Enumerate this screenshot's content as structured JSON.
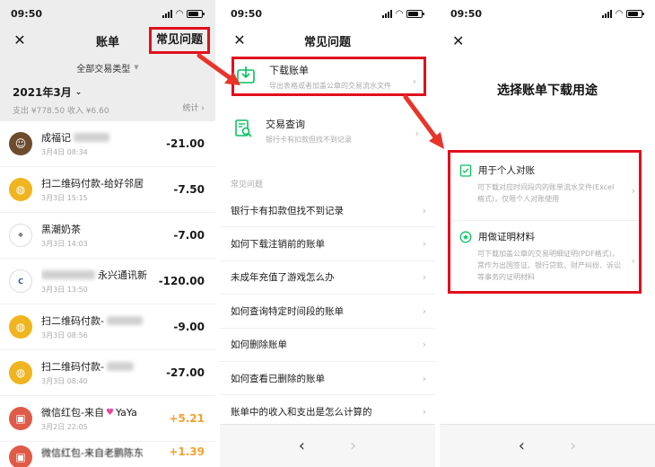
{
  "status": {
    "time": "09:50"
  },
  "screen1": {
    "title": "账单",
    "faq_button": "常见问题",
    "filter": "全部交易类型",
    "month": "2021年3月",
    "summary": "支出 ¥778.50 收入 ¥6.60",
    "stats": "统计",
    "transactions": [
      {
        "name": "成福记",
        "date": "3月4日 08:34",
        "amount": "-21.00",
        "avatar": "brown"
      },
      {
        "name": "扫二维码付款-给好邻居",
        "date": "3月3日 15:15",
        "amount": "-7.50",
        "avatar": "yellow"
      },
      {
        "name": "黑潮奶茶",
        "date": "3月3日 14:03",
        "amount": "-7.00",
        "avatar": "white"
      },
      {
        "name": "永兴通讯新",
        "date": "3月3日 13:50",
        "amount": "-120.00",
        "avatar": "bank"
      },
      {
        "name": "扫二维码付款-",
        "date": "3月3日 08:56",
        "amount": "-9.00",
        "avatar": "yellow"
      },
      {
        "name": "扫二维码付款-",
        "date": "3月3日 08:40",
        "amount": "-27.00",
        "avatar": "yellow"
      },
      {
        "name": "微信红包-来自",
        "name_suffix": "YaYa",
        "date": "3月2日 22:05",
        "amount": "+5.21",
        "avatar": "red"
      },
      {
        "name": "微信红包-来自老鹏陈东",
        "date": "",
        "amount": "+1.39",
        "avatar": "red"
      }
    ]
  },
  "screen2": {
    "title": "常见问题",
    "download": {
      "title": "下载账单",
      "subtitle": "导出表格或者加盖公章的交易流水文件"
    },
    "query": {
      "title": "交易查询",
      "subtitle": "银行卡有扣款但找不到记录"
    },
    "faq_header": "常见问题",
    "faq_items": [
      "银行卡有扣款但找不到记录",
      "如何下载注销前的账单",
      "未成年充值了游戏怎么办",
      "如何查询特定时间段的账单",
      "如何删除账单",
      "如何查看已删除的账单",
      "账单中的收入和支出是怎么计算的"
    ]
  },
  "screen3": {
    "title": "选择账单下载用途",
    "personal": {
      "title": "用于个人对账",
      "desc": "可下载对应时间段内的账单流水文件(Excel格式)，仅限个人对账使用"
    },
    "proof": {
      "title": "用做证明材料",
      "desc": "可下载加盖公章的交易明细证明(PDF格式)，常作为出国签证、银行贷款、财产纠纷、诉讼等事务的证明材料"
    }
  },
  "icons": {
    "close": "close-icon",
    "chevron": "chevron-right-icon",
    "back": "back-arrow-icon",
    "forward": "forward-arrow-icon"
  },
  "colors": {
    "highlight": "#e0101c",
    "wechat_green": "#07c160",
    "income": "#f0a22e"
  }
}
